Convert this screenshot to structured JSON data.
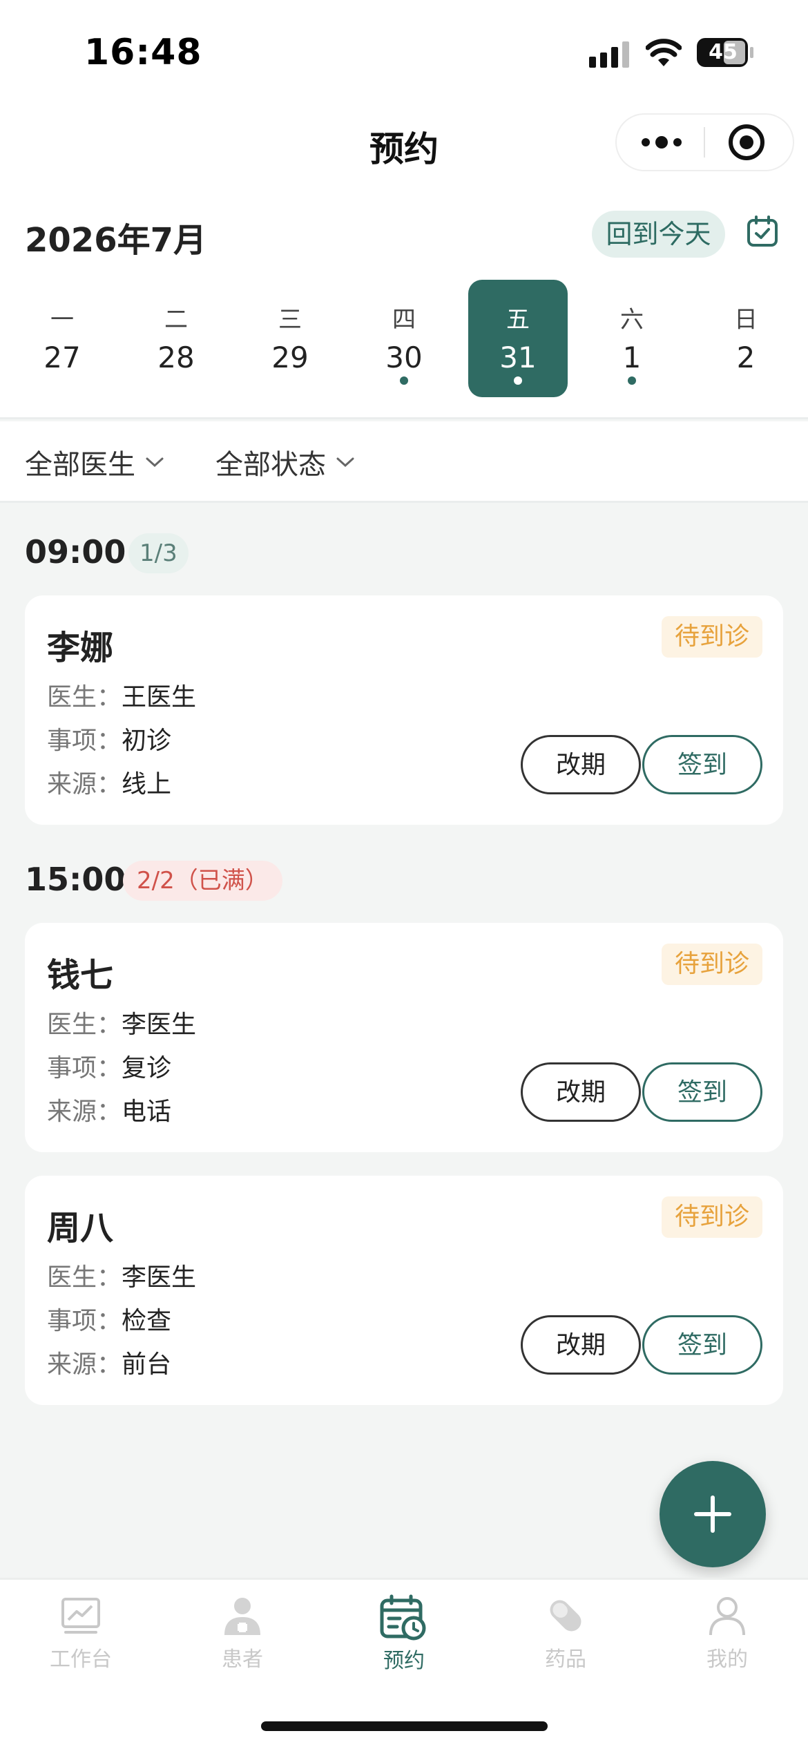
{
  "status_bar": {
    "time": "16:48",
    "battery": "45"
  },
  "nav": {
    "title": "预约",
    "more_icon": "more-dots-icon",
    "close_icon": "target-icon"
  },
  "calendar": {
    "month": "2026年7月",
    "today_label": "回到今天",
    "icon": "calendar-check-icon",
    "days": [
      {
        "weekday": "一",
        "date": "27",
        "has_dot": false,
        "selected": false
      },
      {
        "weekday": "二",
        "date": "28",
        "has_dot": false,
        "selected": false
      },
      {
        "weekday": "三",
        "date": "29",
        "has_dot": false,
        "selected": false
      },
      {
        "weekday": "四",
        "date": "30",
        "has_dot": true,
        "selected": false
      },
      {
        "weekday": "五",
        "date": "31",
        "has_dot": true,
        "selected": true
      },
      {
        "weekday": "六",
        "date": "1",
        "has_dot": true,
        "selected": false
      },
      {
        "weekday": "日",
        "date": "2",
        "has_dot": false,
        "selected": false
      }
    ]
  },
  "filters": {
    "doctor": "全部医生",
    "status": "全部状态"
  },
  "labels": {
    "doctor": "医生：",
    "item": "事项：",
    "source": "来源："
  },
  "slots": [
    {
      "time": "09:00",
      "count": "1/3",
      "full": false,
      "appointments": [
        {
          "name": "李娜",
          "status": "待到诊",
          "doctor": "王医生",
          "item": "初诊",
          "source": "线上",
          "reschedule": "改期",
          "checkin": "签到"
        }
      ]
    },
    {
      "time": "15:00",
      "count": "2/2（已满）",
      "full": true,
      "appointments": [
        {
          "name": "钱七",
          "status": "待到诊",
          "doctor": "李医生",
          "item": "复诊",
          "source": "电话",
          "reschedule": "改期",
          "checkin": "签到"
        },
        {
          "name": "周八",
          "status": "待到诊",
          "doctor": "李医生",
          "item": "检查",
          "source": "前台",
          "reschedule": "改期",
          "checkin": "签到"
        }
      ]
    }
  ],
  "fab": {
    "icon": "plus-icon"
  },
  "tabbar": [
    {
      "label": "工作台",
      "icon": "dashboard-chart-icon",
      "active": false
    },
    {
      "label": "患者",
      "icon": "patient-icon",
      "active": false
    },
    {
      "label": "预约",
      "icon": "calendar-clock-icon",
      "active": true
    },
    {
      "label": "药品",
      "icon": "pill-icon",
      "active": false
    },
    {
      "label": "我的",
      "icon": "user-icon",
      "active": false
    }
  ],
  "colors": {
    "primary": "#2f6b63",
    "pending": "#e7a23c",
    "full": "#d0524a"
  }
}
